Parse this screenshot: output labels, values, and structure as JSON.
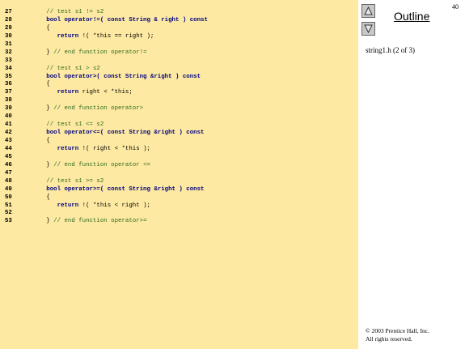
{
  "code_lines": [
    {
      "n": "27",
      "parts": [
        {
          "c": "cmt",
          "t": "   // test s1 != s2"
        }
      ]
    },
    {
      "n": "28",
      "parts": [
        {
          "c": "kw",
          "t": "   bool operator!=( const String & right ) const"
        }
      ]
    },
    {
      "n": "29",
      "parts": [
        {
          "c": "tx",
          "t": "   {"
        }
      ]
    },
    {
      "n": "30",
      "parts": [
        {
          "c": "kw",
          "t": "      return"
        },
        {
          "c": "tx",
          "t": " !( *this == right );"
        }
      ]
    },
    {
      "n": "31",
      "parts": []
    },
    {
      "n": "32",
      "parts": [
        {
          "c": "tx",
          "t": "   } "
        },
        {
          "c": "cmt",
          "t": "// end function operator!="
        }
      ]
    },
    {
      "n": "33",
      "parts": []
    },
    {
      "n": "34",
      "parts": [
        {
          "c": "cmt",
          "t": "   // test s1 > s2"
        }
      ]
    },
    {
      "n": "35",
      "parts": [
        {
          "c": "kw",
          "t": "   bool operator>( const String &right ) const"
        }
      ]
    },
    {
      "n": "36",
      "parts": [
        {
          "c": "tx",
          "t": "   {"
        }
      ]
    },
    {
      "n": "37",
      "parts": [
        {
          "c": "kw",
          "t": "      return"
        },
        {
          "c": "tx",
          "t": " right < *this;"
        }
      ]
    },
    {
      "n": "38",
      "parts": []
    },
    {
      "n": "39",
      "parts": [
        {
          "c": "tx",
          "t": "   } "
        },
        {
          "c": "cmt",
          "t": "// end function operator>"
        }
      ]
    },
    {
      "n": "40",
      "parts": []
    },
    {
      "n": "41",
      "parts": [
        {
          "c": "cmt",
          "t": "   // test s1 <= s2"
        }
      ]
    },
    {
      "n": "42",
      "parts": [
        {
          "c": "kw",
          "t": "   bool operator<=( const String &right ) const"
        }
      ]
    },
    {
      "n": "43",
      "parts": [
        {
          "c": "tx",
          "t": "   {"
        }
      ]
    },
    {
      "n": "44",
      "parts": [
        {
          "c": "kw",
          "t": "      return"
        },
        {
          "c": "tx",
          "t": " !( right < *this );"
        }
      ]
    },
    {
      "n": "45",
      "parts": []
    },
    {
      "n": "46",
      "parts": [
        {
          "c": "tx",
          "t": "   } "
        },
        {
          "c": "cmt",
          "t": "// end function operator <="
        }
      ]
    },
    {
      "n": "47",
      "parts": []
    },
    {
      "n": "48",
      "parts": [
        {
          "c": "cmt",
          "t": "   // test s1 >= s2"
        }
      ]
    },
    {
      "n": "49",
      "parts": [
        {
          "c": "kw",
          "t": "   bool operator>=( const String &right ) const"
        }
      ]
    },
    {
      "n": "50",
      "parts": [
        {
          "c": "tx",
          "t": "   {"
        }
      ]
    },
    {
      "n": "51",
      "parts": [
        {
          "c": "kw",
          "t": "      return"
        },
        {
          "c": "tx",
          "t": " !( *this < right );"
        }
      ]
    },
    {
      "n": "52",
      "parts": []
    },
    {
      "n": "53",
      "parts": [
        {
          "c": "tx",
          "t": "   } "
        },
        {
          "c": "cmt",
          "t": "// end function operator>="
        }
      ]
    }
  ],
  "sidebar": {
    "outline_label": "Outline",
    "page_number": "40",
    "subtitle": "string1.h (2 of 3)",
    "copyright_line1": "© 2003 Prentice Hall, Inc.",
    "copyright_line2": "All rights reserved.",
    "up_icon": "triangle-up-icon",
    "down_icon": "triangle-down-icon"
  },
  "colors": {
    "code_background": "#fde9a1",
    "comment": "#2f6b1f",
    "keyword": "#000080"
  }
}
